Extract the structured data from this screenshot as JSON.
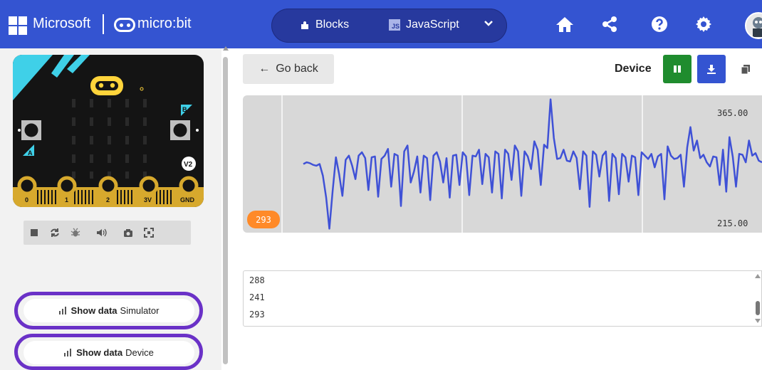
{
  "header": {
    "brand": "Microsoft",
    "product": "micro:bit",
    "tabs": [
      {
        "label": "Blocks"
      },
      {
        "label": "JavaScript"
      }
    ],
    "js_badge": "JS"
  },
  "simulator": {
    "board_labels": {
      "a": "A",
      "b": "B",
      "v2": "V2",
      "pins": [
        "0",
        "1",
        "2",
        "3V",
        "GND"
      ]
    },
    "controls": [
      "stop-icon",
      "restart-icon",
      "debug-icon",
      "sound-icon",
      "screenshot-icon",
      "fullscreen-icon"
    ],
    "show_data_simulator": {
      "bold": "Show data",
      "label": "Simulator"
    },
    "show_data_device": {
      "bold": "Show data",
      "label": "Device"
    }
  },
  "serial": {
    "go_back": "Go back",
    "source_label": "Device",
    "chart_max": "365.00",
    "chart_min": "215.00",
    "current_value": "293",
    "console_lines": [
      "288",
      "241",
      "293"
    ]
  },
  "chart_data": {
    "type": "line",
    "ylim": [
      215,
      365
    ],
    "series": [
      {
        "values": [
          290,
          292,
          291,
          289,
          288,
          290,
          276,
          250,
          213,
          258,
          298,
          278,
          252,
          295,
          300,
          288,
          272,
          300,
          304,
          297,
          259,
          298,
          299,
          251,
          296,
          300,
          308,
          263,
          302,
          300,
          240,
          305,
          312,
          268,
          281,
          299,
          256,
          300,
          297,
          247,
          300,
          304,
          293,
          268,
          297,
          250,
          300,
          301,
          265,
          304,
          299,
          253,
          300,
          299,
          307,
          266,
          302,
          298,
          256,
          305,
          302,
          249,
          307,
          302,
          271,
          312,
          305,
          252,
          305,
          299,
          284,
          317,
          307,
          265,
          313,
          309,
          367,
          321,
          296,
          297,
          307,
          294,
          293,
          305,
          297,
          260,
          305,
          300,
          239,
          305,
          301,
          275,
          300,
          305,
          246,
          302,
          297,
          254,
          302,
          298,
          269,
          300,
          298,
          253,
          304,
          300,
          296,
          302,
          286,
          299,
          302,
          248,
          311,
          300,
          296,
          297,
          301,
          263,
          310,
          334,
          306,
          318,
          297,
          301,
          292,
          287,
          299,
          298,
          265,
          307,
          257,
          322,
          299,
          263,
          302,
          301,
          292,
          318,
          300,
          303,
          294,
          292
        ]
      }
    ],
    "colors": {
      "line": "#3f51d6",
      "plot_bg": "#d8d8d8",
      "grid": "#f3f3f3"
    }
  }
}
